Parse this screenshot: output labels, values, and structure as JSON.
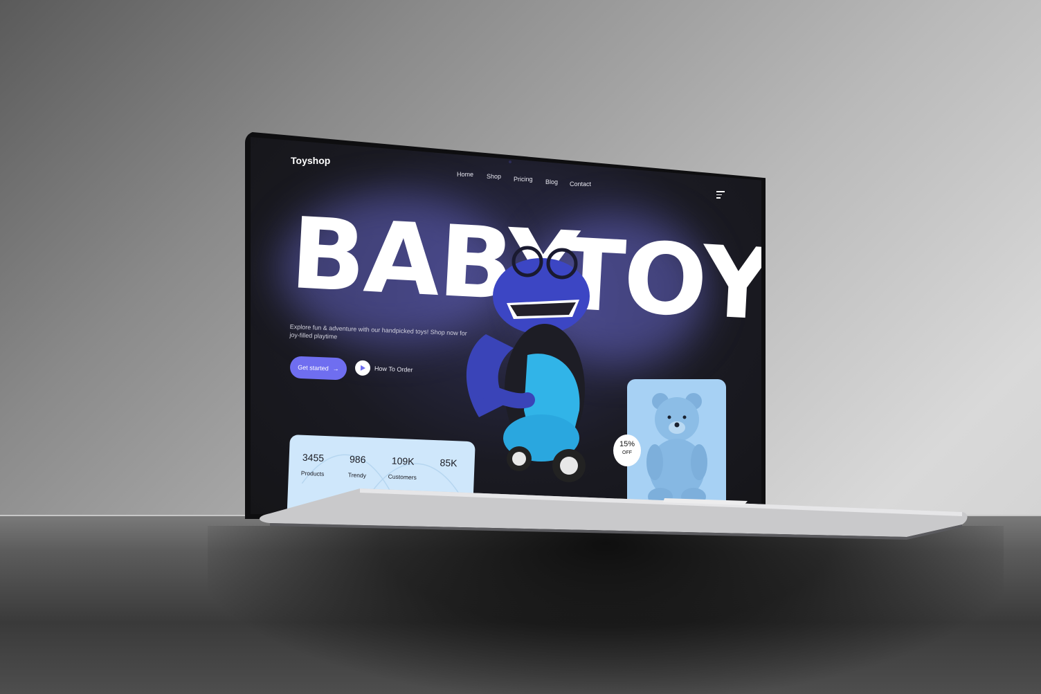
{
  "site": {
    "brand": "Toyshop",
    "nav": [
      "Home",
      "Shop",
      "Pricing",
      "Blog",
      "Contact"
    ]
  },
  "hero": {
    "word1": "BABY",
    "word2": "TOY",
    "tagline": "Explore fun & adventure with our handpicked toys! Shop now for joy-filled playtime",
    "primary_button": "Get started",
    "secondary_button": "How To Order"
  },
  "stats": [
    {
      "value": "3455",
      "label": "Products"
    },
    {
      "value": "986",
      "label": "Trendy"
    },
    {
      "value": "109K",
      "label": "Customers"
    },
    {
      "value": "85K",
      "label": ""
    }
  ],
  "promo": {
    "percent": "15%",
    "off": "OFF"
  },
  "icons": [
    "menu-icon",
    "arrow-right-icon",
    "play-icon",
    "dinosaur-scooter-image",
    "teddy-bear-image"
  ],
  "colors": {
    "accent": "#6f6ef0",
    "stats_card": "#cfe7fb",
    "bear_card": "#a7d1f4",
    "screen_bg": "#1a1a22"
  }
}
